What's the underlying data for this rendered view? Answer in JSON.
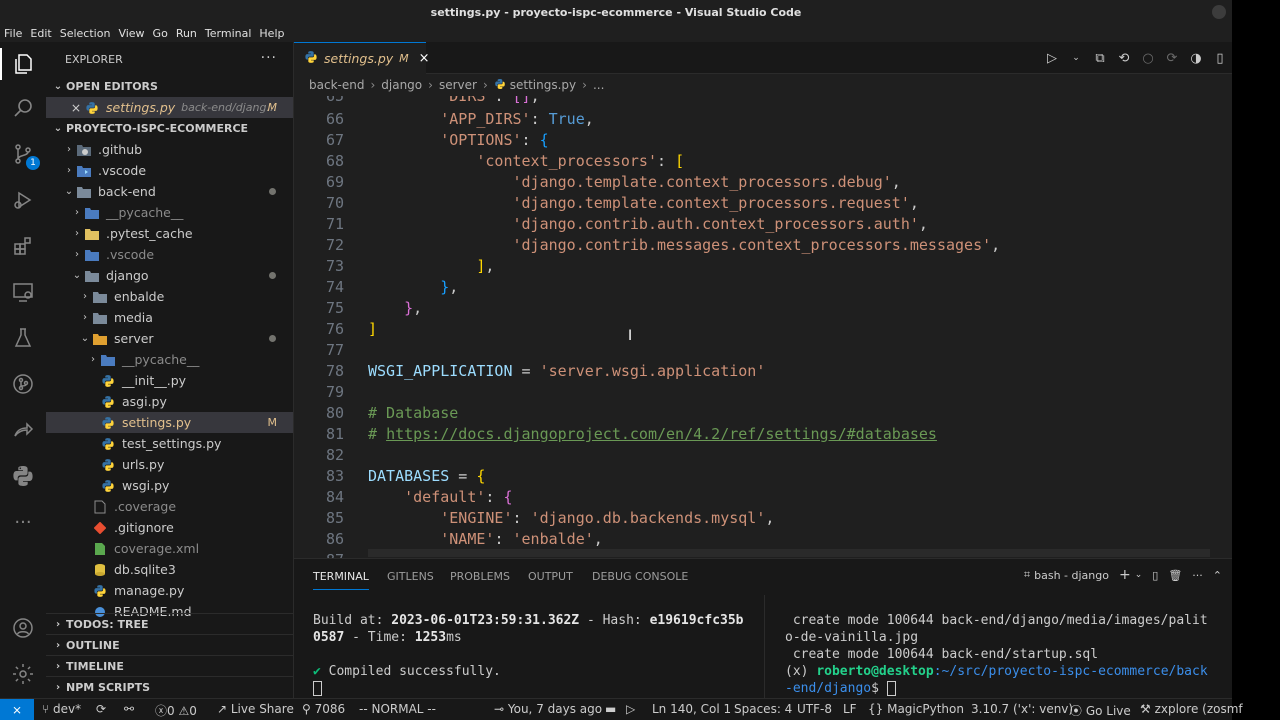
{
  "window": {
    "title": "settings.py - proyecto-ispc-ecommerce - Visual Studio Code"
  },
  "menu": [
    "File",
    "Edit",
    "Selection",
    "View",
    "Go",
    "Run",
    "Terminal",
    "Help"
  ],
  "activity": {
    "source_control_badge": "1"
  },
  "sidebar": {
    "header": "EXPLORER",
    "more": "···",
    "open_editors": {
      "title": "OPEN EDITORS",
      "item": {
        "close": "×",
        "name": "settings.py",
        "path": "back-end/djang...",
        "status": "M"
      }
    },
    "project": {
      "title": "PROYECTO-ISPC-ECOMMERCE",
      "tree": [
        {
          "label": ".github",
          "status": ""
        },
        {
          "label": ".vscode",
          "status": ""
        },
        {
          "label": "back-end",
          "status": "dot"
        },
        {
          "label": "__pycache__",
          "status": ""
        },
        {
          "label": ".pytest_cache",
          "status": ""
        },
        {
          "label": ".vscode",
          "status": ""
        },
        {
          "label": "django",
          "status": "dot"
        },
        {
          "label": "enbalde",
          "status": ""
        },
        {
          "label": "media",
          "status": ""
        },
        {
          "label": "server",
          "status": "dot"
        },
        {
          "label": "__pycache__",
          "status": ""
        },
        {
          "label": "__init__.py",
          "status": ""
        },
        {
          "label": "asgi.py",
          "status": ""
        },
        {
          "label": "settings.py",
          "status": "M"
        },
        {
          "label": "test_settings.py",
          "status": ""
        },
        {
          "label": "urls.py",
          "status": ""
        },
        {
          "label": "wsgi.py",
          "status": ""
        },
        {
          "label": ".coverage",
          "status": ""
        },
        {
          "label": ".gitignore",
          "status": ""
        },
        {
          "label": "coverage.xml",
          "status": ""
        },
        {
          "label": "db.sqlite3",
          "status": ""
        },
        {
          "label": "manage.py",
          "status": ""
        },
        {
          "label": "README.md",
          "status": ""
        }
      ]
    },
    "bottom_sections": [
      "TODOS: TREE",
      "OUTLINE",
      "TIMELINE",
      "NPM SCRIPTS"
    ]
  },
  "tab": {
    "name": "settings.py",
    "status": "M",
    "close": "×"
  },
  "breadcrumb": [
    "back-end",
    "django",
    "server",
    "settings.py",
    "..."
  ],
  "editor": {
    "line_numbers": [
      "65",
      "66",
      "67",
      "68",
      "69",
      "70",
      "71",
      "72",
      "73",
      "74",
      "75",
      "76",
      "77",
      "78",
      "79",
      "80",
      "81",
      "82",
      "83",
      "84",
      "85",
      "86",
      "87"
    ]
  },
  "panel": {
    "tabs": [
      "TERMINAL",
      "GITLENS",
      "PROBLEMS",
      "OUTPUT",
      "DEBUG CONSOLE"
    ],
    "terminal_name": "bash - django",
    "left_terminal": {
      "build_label": "Build at: ",
      "build_time": "2023-06-01T23:59:31.362Z",
      "hash_label": " - Hash: ",
      "hash": "e19619cfc35b",
      "hash_cont": "0587",
      "time_label": " - Time: ",
      "time": "1253",
      "time_unit": "ms",
      "check": "✔",
      "compiled": " Compiled successfully."
    },
    "right_terminal": {
      "line1": " create mode 100644 back-end/django/media/images/palit",
      "line2": "o-de-vainilla.jpg",
      "line3": " create mode 100644 back-end/startup.sql",
      "venv": "(x) ",
      "user": "roberto@desktop",
      "path": ":~/src/proyecto-ispc-ecommerce/back",
      "path2": "-end/django",
      "dollar": "$ "
    }
  },
  "status": {
    "branch": "dev*",
    "errors": "0",
    "warnings": "0",
    "live_share": "Live Share",
    "port": "7086",
    "vim_mode": "-- NORMAL --",
    "blame": "You, 7 days ago",
    "cursor": "Ln 140, Col 1",
    "spaces": "Spaces: 4",
    "encoding": "UTF-8",
    "eol": "LF",
    "language": "MagicPython",
    "interpreter": "3.10.7 ('x': venv)",
    "go_live": "Go Live",
    "zxplore": "zxplore (zosmf"
  },
  "colors": {
    "accent": "#0078d4",
    "modified": "#e2c08d",
    "string": "#ce9178",
    "keyword": "#569cd6",
    "comment": "#6a9955"
  }
}
